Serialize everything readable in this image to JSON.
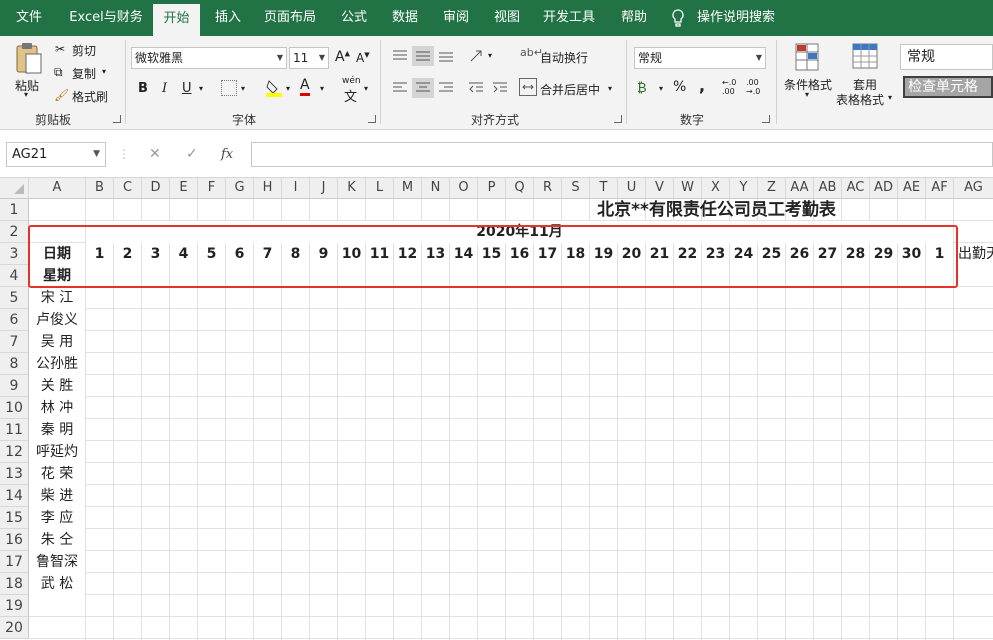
{
  "tabs": [
    "文件",
    "Excel与财务",
    "开始",
    "插入",
    "页面布局",
    "公式",
    "数据",
    "审阅",
    "视图",
    "开发工具",
    "帮助",
    "操作说明搜索"
  ],
  "clipboard": {
    "paste": "粘贴",
    "cut": "剪切",
    "copy": "复制",
    "format_painter": "格式刷",
    "group": "剪贴板"
  },
  "font": {
    "name": "微软雅黑",
    "size": "11",
    "group": "字体",
    "bold": "B",
    "italic": "I",
    "underline": "U",
    "grow": "A",
    "shrink": "A",
    "color_letter": "A",
    "pinyin": "wén"
  },
  "alignment": {
    "wrap_text": "自动换行",
    "merge_center": "合并后居中",
    "group": "对齐方式"
  },
  "number": {
    "format": "常规",
    "percent": "%",
    "comma": ",",
    "group": "数字"
  },
  "styles": {
    "conditional": "条件格式",
    "table_fmt_1": "套用",
    "table_fmt_2": "表格格式",
    "style_normal": "常规",
    "style_check": "检查单元格"
  },
  "formula_bar": {
    "name_box": "AG21",
    "cancel": "✕",
    "enter": "✓",
    "fx": "fx",
    "value": ""
  },
  "columns": [
    "A",
    "B",
    "C",
    "D",
    "E",
    "F",
    "G",
    "H",
    "I",
    "J",
    "K",
    "L",
    "M",
    "N",
    "O",
    "P",
    "Q",
    "R",
    "S",
    "T",
    "U",
    "V",
    "W",
    "X",
    "Y",
    "Z",
    "AA",
    "AB",
    "AC",
    "AD",
    "AE",
    "AF",
    "AG"
  ],
  "rows": [
    "1",
    "2",
    "3",
    "4",
    "5",
    "6",
    "7",
    "8",
    "9",
    "10",
    "11",
    "12",
    "13",
    "14",
    "15",
    "16",
    "17",
    "18",
    "19",
    "20"
  ],
  "sheet": {
    "title": "北京**有限责任公司员工考勤表",
    "month": "2020年11月",
    "date_label": "日期",
    "weekday_label": "星期",
    "days": [
      "1",
      "2",
      "3",
      "4",
      "5",
      "6",
      "7",
      "8",
      "9",
      "10",
      "11",
      "12",
      "13",
      "14",
      "15",
      "16",
      "17",
      "18",
      "19",
      "20",
      "21",
      "22",
      "23",
      "24",
      "25",
      "26",
      "27",
      "28",
      "29",
      "30",
      "1"
    ],
    "attendance_label": "出勤天",
    "employees": [
      "宋 江",
      "卢俊义",
      "吴 用",
      "公孙胜",
      "关 胜",
      "林 冲",
      "秦 明",
      "呼延灼",
      "花 荣",
      "柴 进",
      "李 应",
      "朱 仝",
      "鲁智深",
      "武 松"
    ]
  },
  "colors": {
    "accent": "#217346",
    "highlight_box": "#e5332a"
  }
}
